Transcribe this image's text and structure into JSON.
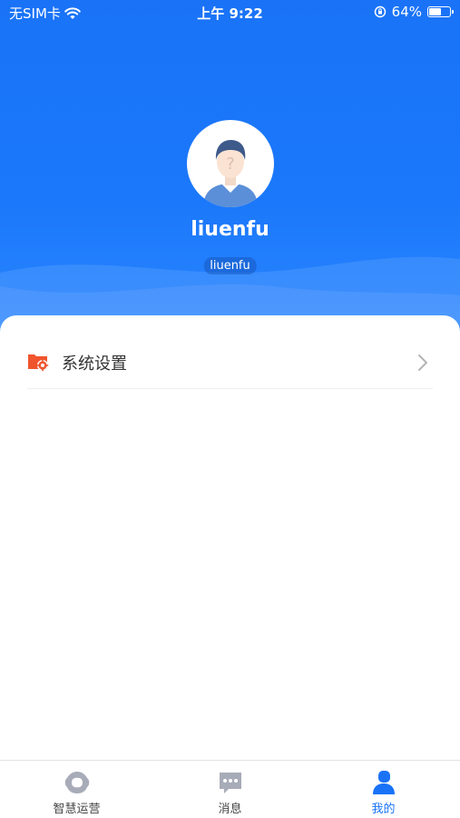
{
  "status_bar": {
    "carrier": "无SIM卡",
    "time": "上午 9:22",
    "battery": "64%",
    "battery_level": 0.64,
    "icons": [
      "wifi-icon",
      "orientation-lock-icon",
      "battery-icon"
    ]
  },
  "profile": {
    "username": "liuenfu",
    "account": "liuenfu",
    "avatar_icon": "default-avatar-icon"
  },
  "menu": {
    "items": [
      {
        "label": "系统设置",
        "icon": "settings-icon"
      }
    ]
  },
  "tab_bar": {
    "tabs": [
      {
        "label": "智慧运营",
        "icon": "smart-ops-icon",
        "active": false
      },
      {
        "label": "消息",
        "icon": "message-icon",
        "active": false
      },
      {
        "label": "我的",
        "icon": "profile-icon",
        "active": true
      }
    ]
  },
  "colors": {
    "primary": "#1a73f7",
    "accent_orange": "#f0552d",
    "tab_inactive_icon": "#a8abb8"
  }
}
